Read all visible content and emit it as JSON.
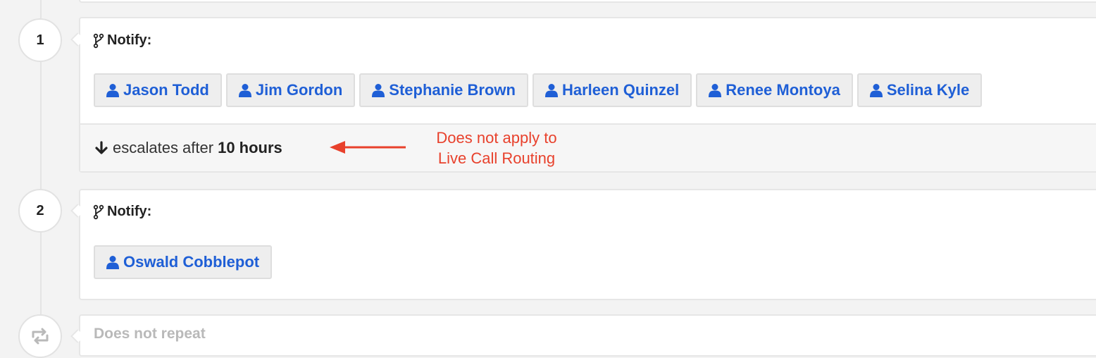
{
  "colors": {
    "link": "#1f5fd6",
    "annotation": "#e8412c",
    "muted": "#b9b9b9"
  },
  "levels": [
    {
      "number": "1",
      "notify_label": "Notify:",
      "targets": [
        "Jason Todd",
        "Jim Gordon",
        "Stephanie Brown",
        "Harleen Quinzel",
        "Renee Montoya",
        "Selina Kyle"
      ],
      "escalation": {
        "prefix": "escalates after",
        "value": "10 hours"
      }
    },
    {
      "number": "2",
      "notify_label": "Notify:",
      "targets": [
        "Oswald Cobblepot"
      ]
    }
  ],
  "annotation": {
    "line1": "Does not apply to",
    "line2": "Live Call Routing"
  },
  "repeat": {
    "text": "Does not repeat",
    "icon": "repeat-icon"
  }
}
